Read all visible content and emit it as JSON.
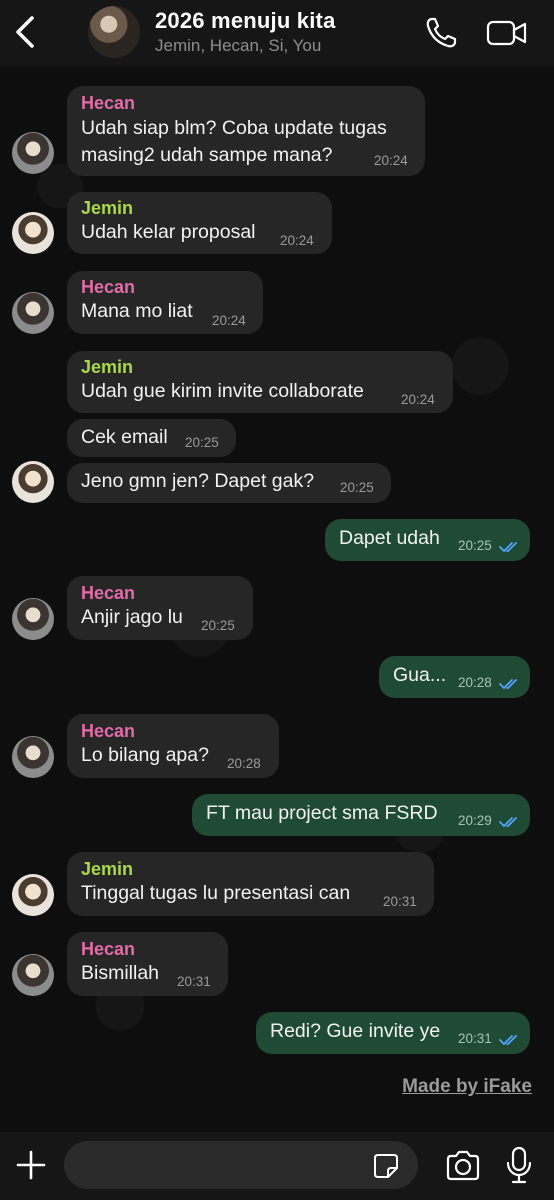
{
  "header": {
    "title": "2026 menuju kita",
    "subtitle": "Jemin, Hecan, Si, You"
  },
  "messages": [
    {
      "sender": "Hecan",
      "text1": "Udah siap blm? Coba update tugas",
      "text2": "masing2 udah sampe mana?",
      "time": "20:24"
    },
    {
      "sender": "Jemin",
      "text": "Udah kelar proposal",
      "time": "20:24"
    },
    {
      "sender": "Hecan",
      "text": "Mana mo liat",
      "time": "20:24"
    },
    {
      "sender": "Jemin",
      "text": "Udah gue kirim invite collaborate",
      "time": "20:24"
    },
    {
      "text": "Cek email",
      "time": "20:25"
    },
    {
      "text": "Jeno gmn jen? Dapet gak?",
      "time": "20:25"
    },
    {
      "text": "Dapet udah",
      "time": "20:25"
    },
    {
      "sender": "Hecan",
      "text": "Anjir jago lu",
      "time": "20:25"
    },
    {
      "text": "Gua...",
      "time": "20:28"
    },
    {
      "sender": "Hecan",
      "text": "Lo bilang apa?",
      "time": "20:28"
    },
    {
      "text": "FT mau project sma FSRD",
      "time": "20:29"
    },
    {
      "sender": "Jemin",
      "text": "Tinggal tugas lu presentasi can",
      "time": "20:31"
    },
    {
      "sender": "Hecan",
      "text": "Bismillah",
      "time": "20:31"
    },
    {
      "text": "Redi? Gue invite ye",
      "time": "20:31"
    }
  ],
  "watermark": "Made by iFake",
  "footer": {
    "input_value": ""
  },
  "colors": {
    "incoming": "#262626",
    "outgoing": "#1f4a33",
    "hecan": "#e36aa8",
    "jemin": "#a9d94a",
    "read_ticks": "#53a6ff"
  },
  "icons": [
    "back-arrow-icon",
    "phone-icon",
    "video-icon",
    "plus-icon",
    "sticker-icon",
    "camera-icon",
    "mic-icon",
    "double-check-icon"
  ]
}
